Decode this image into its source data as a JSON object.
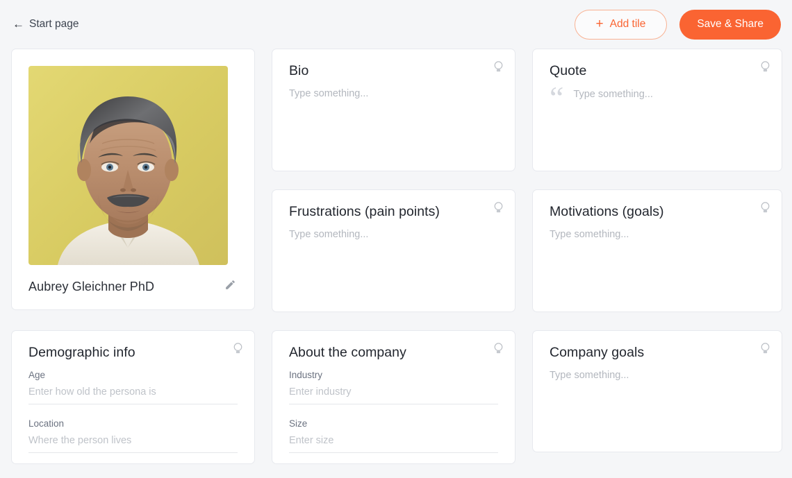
{
  "header": {
    "back_label": "Start page",
    "back_icon": "arrow-left-icon",
    "add_tile_label": "Add tile",
    "add_tile_icon": "plus-icon",
    "save_share_label": "Save & Share",
    "accent_color": "#fa6432",
    "accent_border_color": "#f9b293"
  },
  "persona": {
    "name": "Aubrey Gleichner PhD",
    "edit_icon": "pencil-icon",
    "photo_alt": "portrait-photo",
    "photo_background_color": "#ddd16a"
  },
  "tiles": {
    "bio": {
      "title": "Bio",
      "placeholder": "Type something...",
      "hint_icon": "lightbulb-icon"
    },
    "quote": {
      "title": "Quote",
      "placeholder": "Type something...",
      "quote_mark": "“",
      "hint_icon": "lightbulb-icon"
    },
    "frustrations": {
      "title": "Frustrations (pain points)",
      "placeholder": "Type something...",
      "hint_icon": "lightbulb-icon"
    },
    "motivations": {
      "title": "Motivations (goals)",
      "placeholder": "Type something...",
      "hint_icon": "lightbulb-icon"
    },
    "demographic": {
      "title": "Demographic info",
      "hint_icon": "lightbulb-icon",
      "fields": [
        {
          "label": "Age",
          "value": "",
          "placeholder": "Enter how old the persona is"
        },
        {
          "label": "Location",
          "value": "",
          "placeholder": "Where the person lives"
        }
      ]
    },
    "company": {
      "title": "About the company",
      "hint_icon": "lightbulb-icon",
      "fields": [
        {
          "label": "Industry",
          "value": "",
          "placeholder": "Enter industry"
        },
        {
          "label": "Size",
          "value": "",
          "placeholder": "Enter size"
        }
      ]
    },
    "company_goals": {
      "title": "Company goals",
      "placeholder": "Type something...",
      "hint_icon": "lightbulb-icon"
    }
  }
}
